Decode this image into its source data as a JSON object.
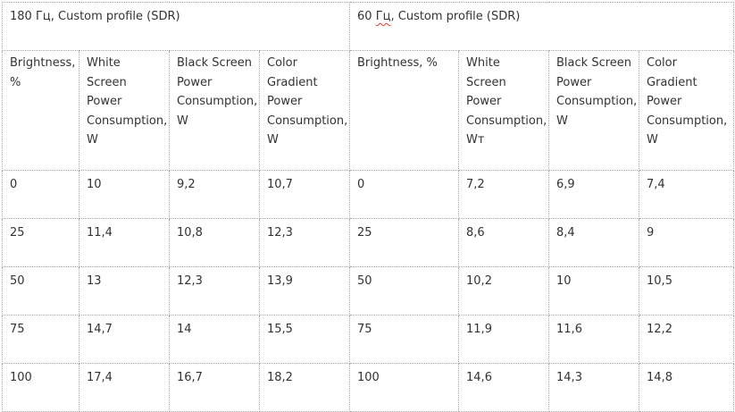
{
  "groups": [
    {
      "hz": "180 Гц",
      "rest": ", Custom profile (SDR)"
    },
    {
      "hz": "60 Гц",
      "rest": ", Custom profile (SDR)"
    }
  ],
  "headers": [
    [
      "Brightness, %",
      "White Screen Power Consumption, W",
      "Black Screen Power Consumption, W",
      "Color Gradient Power Consumption, W"
    ],
    [
      "Brightness, %",
      "White Screen Power Consumption, Wт",
      "Black Screen Power Consumption, W",
      "Color Gradient Power Consumption, W"
    ]
  ],
  "rows": [
    [
      "0",
      "10",
      "9,2",
      "10,7",
      "0",
      "7,2",
      "6,9",
      "7,4"
    ],
    [
      "25",
      "11,4",
      "10,8",
      "12,3",
      "25",
      "8,6",
      "8,4",
      "9"
    ],
    [
      "50",
      "13",
      "12,3",
      "13,9",
      "50",
      "10,2",
      "10",
      "10,5"
    ],
    [
      "75",
      "14,7",
      "14",
      "15,5",
      "75",
      "11,9",
      "11,6",
      "12,2"
    ],
    [
      "100",
      "17,4",
      "16,7",
      "18,2",
      "100",
      "14,6",
      "14,3",
      "14,8"
    ]
  ]
}
